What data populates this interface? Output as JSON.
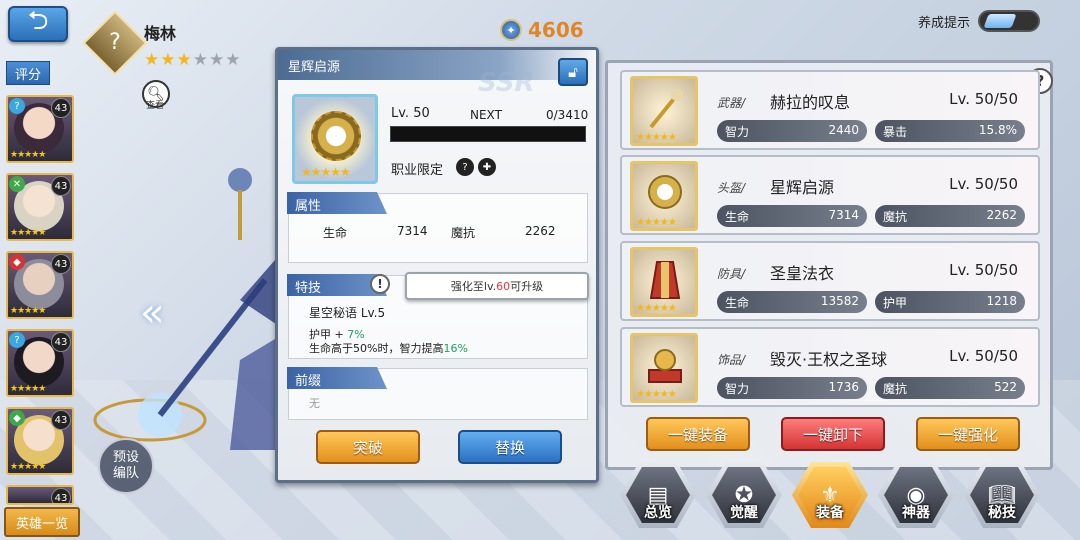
{
  "header": {
    "back_icon": "back-arrow-icon",
    "hero_name": "梅林",
    "hero_stars_on": "★★★",
    "hero_stars_off": "★★★",
    "view_label": "查看",
    "power_value": "4606",
    "tips_label": "养成提示"
  },
  "sidebar": {
    "rate_label": "评分",
    "heroes": [
      {
        "level": "43",
        "class_color": "#3aa7e0",
        "class_glyph": "?",
        "stars": "★★★★★"
      },
      {
        "level": "43",
        "class_color": "#3fa84a",
        "class_glyph": "✕",
        "stars": "★★★★★"
      },
      {
        "level": "43",
        "class_color": "#d43434",
        "class_glyph": "◆",
        "stars": "★★★★★"
      },
      {
        "level": "43",
        "class_color": "#3aa7e0",
        "class_glyph": "?",
        "stars": "★★★★★"
      },
      {
        "level": "43",
        "class_color": "#3fa84a",
        "class_glyph": "◆",
        "stars": "★★★★★"
      },
      {
        "level": "43"
      }
    ],
    "hero_list_label": "英雄一览"
  },
  "preset": {
    "line1": "预设",
    "line2": "编队"
  },
  "detail": {
    "title": "星辉启源",
    "watermark": "SSR",
    "level": "Lv. 50",
    "next_label": "NEXT",
    "exp": "0/3410",
    "exp_progress": 0,
    "job_label": "职业限定",
    "attr_tab": "属性",
    "attr": {
      "hp_label": "生命",
      "hp_value": "7314",
      "mres_label": "魔抗",
      "mres_value": "2262"
    },
    "skill_tab": "特技",
    "skill_name": "星空秘语  Lv.5",
    "skill_line1_a": "护甲 + ",
    "skill_line1_b": "7%",
    "skill_line2_a": "生命高于50%时，智力提高",
    "skill_line2_b": "16%",
    "tooltip_a": "强化至lv.",
    "tooltip_b": "60",
    "tooltip_c": "可升级",
    "prefix_tab": "前缀",
    "prefix_value": "无",
    "breakthrough_label": "突破",
    "replace_label": "替换"
  },
  "equipment": [
    {
      "type": "武器/",
      "name": "赫拉的叹息",
      "level": "Lv. 50/50",
      "stat1_label": "智力",
      "stat1_value": "2440",
      "stat2_label": "暴击",
      "stat2_value": "15.8%",
      "stars": "★★★★★"
    },
    {
      "type": "头盔/",
      "name": "星辉启源",
      "level": "Lv. 50/50",
      "stat1_label": "生命",
      "stat1_value": "7314",
      "stat2_label": "魔抗",
      "stat2_value": "2262",
      "stars": "★★★★★"
    },
    {
      "type": "防具/",
      "name": "圣皇法衣",
      "level": "Lv. 50/50",
      "stat1_label": "生命",
      "stat1_value": "13582",
      "stat2_label": "护甲",
      "stat2_value": "1218",
      "stars": "★★★★★"
    },
    {
      "type": "饰品/",
      "name": "毁灭·王权之圣球",
      "level": "Lv. 50/50",
      "stat1_label": "智力",
      "stat1_value": "1736",
      "stat2_label": "魔抗",
      "stat2_value": "522",
      "stars": "★★★★★"
    }
  ],
  "actions": {
    "equip_all": "一键装备",
    "unequip_all": "一键卸下",
    "enhance_all": "一键强化"
  },
  "nav": [
    {
      "label": "总览",
      "icon": "document-icon"
    },
    {
      "label": "觉醒",
      "icon": "awaken-icon"
    },
    {
      "label": "装备",
      "icon": "equip-icon"
    },
    {
      "label": "神器",
      "icon": "artifact-icon"
    },
    {
      "label": "秘技",
      "icon": "book-icon"
    }
  ],
  "colors": {
    "accent_orange": "#e3901d",
    "accent_blue": "#2b70c2",
    "accent_red": "#d43434",
    "gold": "#f2b71b"
  }
}
